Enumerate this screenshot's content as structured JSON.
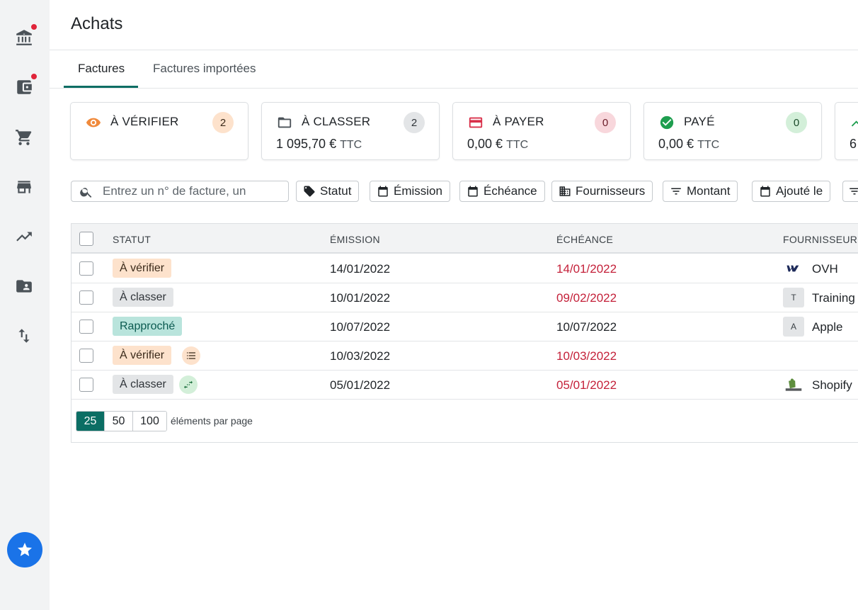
{
  "app": {
    "title": "Achats",
    "tabs": [
      {
        "label": "Factures",
        "active": true
      },
      {
        "label": "Factures importées",
        "active": false
      }
    ]
  },
  "sidebar": {
    "items": [
      {
        "icon": "bank-icon",
        "notification": true
      },
      {
        "icon": "wallet-icon",
        "notification": true
      },
      {
        "icon": "cart-icon",
        "notification": false
      },
      {
        "icon": "store-icon",
        "notification": false
      },
      {
        "icon": "trending-up-icon",
        "notification": false
      },
      {
        "icon": "folder-account-icon",
        "notification": false
      },
      {
        "icon": "swap-vertical-icon",
        "notification": false
      }
    ],
    "favorite_icon": "star-icon"
  },
  "status_cards": [
    {
      "label": "À VÉRIFIER",
      "count": "2",
      "amount": "",
      "ttc": "",
      "icon": "eye-icon",
      "icon_color": "#f08a3c",
      "count_bg": "#fde2cc",
      "count_color": "#3a2a1a"
    },
    {
      "label": "À CLASSER",
      "count": "2",
      "amount": "1 095,70 €",
      "ttc": "TTC",
      "icon": "folder-icon",
      "icon_color": "#4b5258",
      "count_bg": "#e3e5e7",
      "count_color": "#2f3439"
    },
    {
      "label": "À PAYER",
      "count": "0",
      "amount": "0,00 €",
      "ttc": "TTC",
      "icon": "credit-card-icon",
      "icon_color": "#d9304a",
      "count_bg": "#f8d7dc",
      "count_color": "#6a1c28"
    },
    {
      "label": "PAYÉ",
      "count": "0",
      "amount": "0,00 €",
      "ttc": "TTC",
      "icon": "check-circle-icon",
      "icon_color": "#1e9e4f",
      "count_bg": "#d3efd9",
      "count_color": "#1a4a2a"
    },
    {
      "label": "",
      "count": "",
      "amount": "6",
      "ttc": "",
      "icon": "trend-icon",
      "icon_color": "#1e9e4f",
      "count_bg": "",
      "count_color": ""
    }
  ],
  "search": {
    "placeholder": "Entrez un n° de facture, un"
  },
  "filters": [
    {
      "label": "Statut",
      "icon": "tag-icon"
    },
    {
      "label": "Émission",
      "icon": "calendar-icon"
    },
    {
      "label": "Échéance",
      "icon": "calendar-icon"
    },
    {
      "label": "Fournisseurs",
      "icon": "building-icon"
    },
    {
      "label": "Montant",
      "icon": "filter-icon"
    },
    {
      "label": "Ajouté le",
      "icon": "calendar-icon"
    },
    {
      "label": "",
      "icon": "filter-icon"
    }
  ],
  "table": {
    "headers": {
      "status": "STATUT",
      "emission": "ÉMISSION",
      "echeance": "ÉCHÉANCE",
      "fournisseur": "FOURNISSEUR"
    },
    "rows": [
      {
        "status": "À vérifier",
        "status_type": "verifier",
        "extra": "",
        "emission": "14/01/2022",
        "echeance": "14/01/2022",
        "echeance_overdue": true,
        "supplier": "OVH",
        "supplier_logo": "ovh-logo-icon",
        "supplier_letter": ""
      },
      {
        "status": "À classer",
        "status_type": "classer",
        "extra": "",
        "emission": "10/01/2022",
        "echeance": "09/02/2022",
        "echeance_overdue": true,
        "supplier": "Training",
        "supplier_logo": "",
        "supplier_letter": "T"
      },
      {
        "status": "Rapproché",
        "status_type": "rapproche",
        "extra": "",
        "emission": "10/07/2022",
        "echeance": "10/07/2022",
        "echeance_overdue": false,
        "supplier": "Apple",
        "supplier_logo": "",
        "supplier_letter": "A"
      },
      {
        "status": "À vérifier",
        "status_type": "verifier",
        "extra": "list-icon",
        "emission": "10/03/2022",
        "echeance": "10/03/2022",
        "echeance_overdue": true,
        "supplier": "",
        "supplier_logo": "",
        "supplier_letter": ""
      },
      {
        "status": "À classer",
        "status_type": "classer",
        "extra": "transfer-icon",
        "emission": "05/01/2022",
        "echeance": "05/01/2022",
        "echeance_overdue": true,
        "supplier": "Shopify",
        "supplier_logo": "shopify-logo-icon",
        "supplier_letter": ""
      }
    ]
  },
  "pagination": {
    "sizes": [
      "25",
      "50",
      "100"
    ],
    "active": "25",
    "label": "éléments par page"
  }
}
